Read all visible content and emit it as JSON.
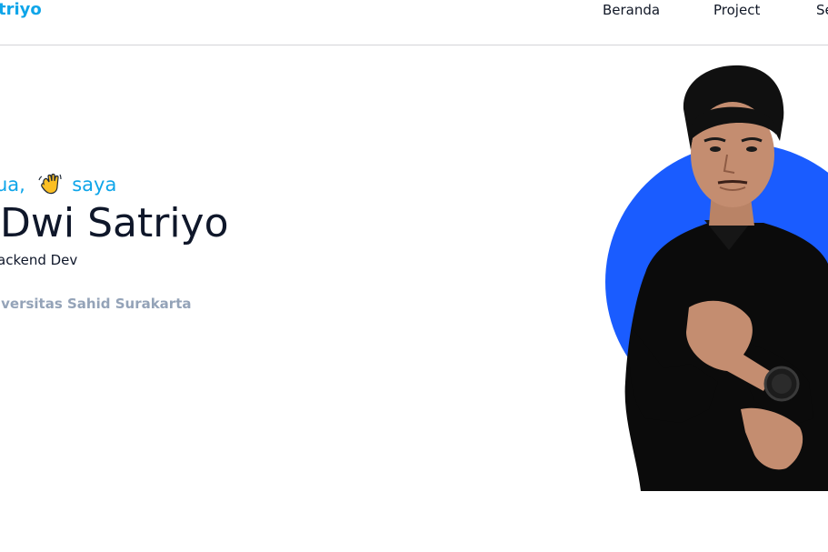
{
  "navbar": {
    "brand": "triyo",
    "links": [
      "Beranda",
      "Project",
      "Se"
    ]
  },
  "hero": {
    "greeting_pre": "ua,",
    "greeting_post": "saya",
    "greeting_icon": "waving-hand-icon",
    "name": "Dwi Satriyo",
    "role": "ackend Dev",
    "campus": "iversitas Sahid Surakarta"
  },
  "colors": {
    "accent": "#0ea5e9",
    "hero_circle": "#1a5cff",
    "heading": "#0f172a",
    "muted": "#94a3b8"
  }
}
